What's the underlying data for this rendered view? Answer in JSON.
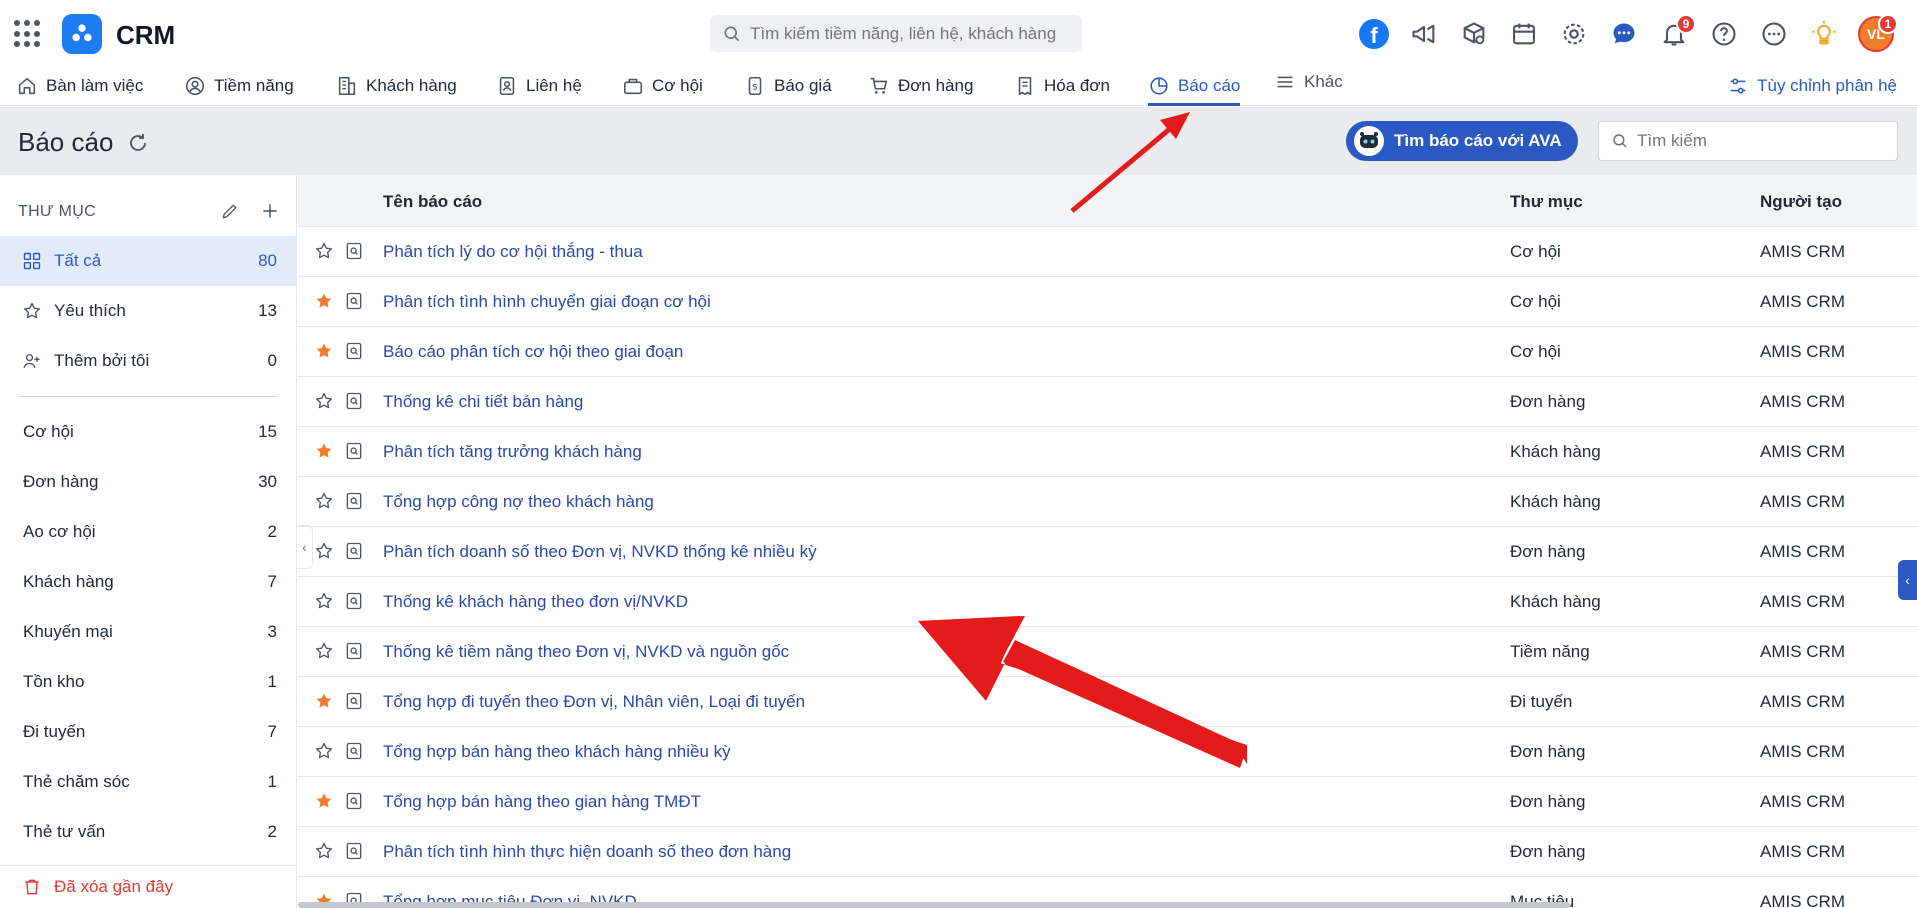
{
  "app": {
    "title": "CRM"
  },
  "search": {
    "placeholder": "Tìm kiếm tiềm năng, liên hệ, khách hàng"
  },
  "notifications": {
    "count": "9"
  },
  "user": {
    "initials": "VL",
    "badge": "1"
  },
  "nav": {
    "items": [
      {
        "label": "Bàn làm việc",
        "icon": "home-icon"
      },
      {
        "label": "Tiềm năng",
        "icon": "person-circle-icon"
      },
      {
        "label": "Khách hàng",
        "icon": "building-icon"
      },
      {
        "label": "Liên hệ",
        "icon": "contact-card-icon"
      },
      {
        "label": "Cơ hội",
        "icon": "briefcase-icon"
      },
      {
        "label": "Báo giá",
        "icon": "quote-icon"
      },
      {
        "label": "Đơn hàng",
        "icon": "cart-icon"
      },
      {
        "label": "Hóa đơn",
        "icon": "invoice-icon"
      },
      {
        "label": "Báo cáo",
        "icon": "pie-chart-icon"
      },
      {
        "label": "Khác",
        "icon": "menu-icon"
      }
    ],
    "active": "Báo cáo",
    "customize_label": "Tùy chỉnh phân hệ"
  },
  "page": {
    "title": "Báo cáo",
    "ava_button": "Tìm báo cáo với AVA",
    "search_placeholder": "Tìm kiếm"
  },
  "sidebar": {
    "heading": "THƯ MỤC",
    "filters": [
      {
        "label": "Tất cả",
        "count": "80",
        "active": true
      },
      {
        "label": "Yêu thích",
        "count": "13",
        "active": false
      },
      {
        "label": "Thêm bởi tôi",
        "count": "0",
        "active": false
      }
    ],
    "folders": [
      {
        "label": "Cơ hội",
        "count": "15"
      },
      {
        "label": "Đơn hàng",
        "count": "30"
      },
      {
        "label": "Ao cơ hội",
        "count": "2"
      },
      {
        "label": "Khách hàng",
        "count": "7"
      },
      {
        "label": "Khuyến mại",
        "count": "3"
      },
      {
        "label": "Tồn kho",
        "count": "1"
      },
      {
        "label": "Đi tuyến",
        "count": "7"
      },
      {
        "label": "Thẻ chăm sóc",
        "count": "1"
      },
      {
        "label": "Thẻ tư vấn",
        "count": "2"
      }
    ],
    "deleted_label": "Đã xóa gần đây"
  },
  "table": {
    "columns": {
      "name": "Tên báo cáo",
      "folder": "Thư mục",
      "creator": "Người tạo"
    },
    "rows": [
      {
        "name": "Phân tích lý do cơ hội thắng - thua",
        "folder": "Cơ hội",
        "creator": "AMIS CRM",
        "favorite": false
      },
      {
        "name": "Phân tích tình hình chuyển giai đoạn cơ hội",
        "folder": "Cơ hội",
        "creator": "AMIS CRM",
        "favorite": true
      },
      {
        "name": "Báo cáo phân tích cơ hội theo giai đoạn",
        "folder": "Cơ hội",
        "creator": "AMIS CRM",
        "favorite": true
      },
      {
        "name": "Thống kê chi tiết bán hàng",
        "folder": "Đơn hàng",
        "creator": "AMIS CRM",
        "favorite": false
      },
      {
        "name": "Phân tích tăng trưởng khách hàng",
        "folder": "Khách hàng",
        "creator": "AMIS CRM",
        "favorite": true
      },
      {
        "name": "Tổng hợp công nợ theo khách hàng",
        "folder": "Khách hàng",
        "creator": "AMIS CRM",
        "favorite": false
      },
      {
        "name": "Phân tích doanh số theo Đơn vị, NVKD thống kê nhiều kỳ",
        "folder": "Đơn hàng",
        "creator": "AMIS CRM",
        "favorite": false
      },
      {
        "name": "Thống kê khách hàng theo đơn vị/NVKD",
        "folder": "Khách hàng",
        "creator": "AMIS CRM",
        "favorite": false
      },
      {
        "name": "Thống kê tiềm năng theo Đơn vị, NVKD và nguồn gốc",
        "folder": "Tiềm năng",
        "creator": "AMIS CRM",
        "favorite": false
      },
      {
        "name": "Tổng hợp đi tuyến theo Đơn vị, Nhân viên, Loại đi tuyến",
        "folder": "Đi tuyến",
        "creator": "AMIS CRM",
        "favorite": true
      },
      {
        "name": "Tổng hợp bán hàng theo khách hàng nhiều kỳ",
        "folder": "Đơn hàng",
        "creator": "AMIS CRM",
        "favorite": false
      },
      {
        "name": "Tổng hợp bán hàng theo gian hàng TMĐT",
        "folder": "Đơn hàng",
        "creator": "AMIS CRM",
        "favorite": true
      },
      {
        "name": "Phân tích tình hình thực hiện doanh số theo đơn hàng",
        "folder": "Đơn hàng",
        "creator": "AMIS CRM",
        "favorite": false
      },
      {
        "name": "Tổng hợp mục tiêu Đơn vị, NVKD",
        "folder": "Mục tiêu",
        "creator": "AMIS CRM",
        "favorite": true
      }
    ]
  },
  "colors": {
    "accent": "#2b59c3",
    "link": "#2b47a8",
    "favorite_star": "#f07d2b",
    "annotation_arrow": "#e31b1b",
    "danger": "#e53935"
  }
}
